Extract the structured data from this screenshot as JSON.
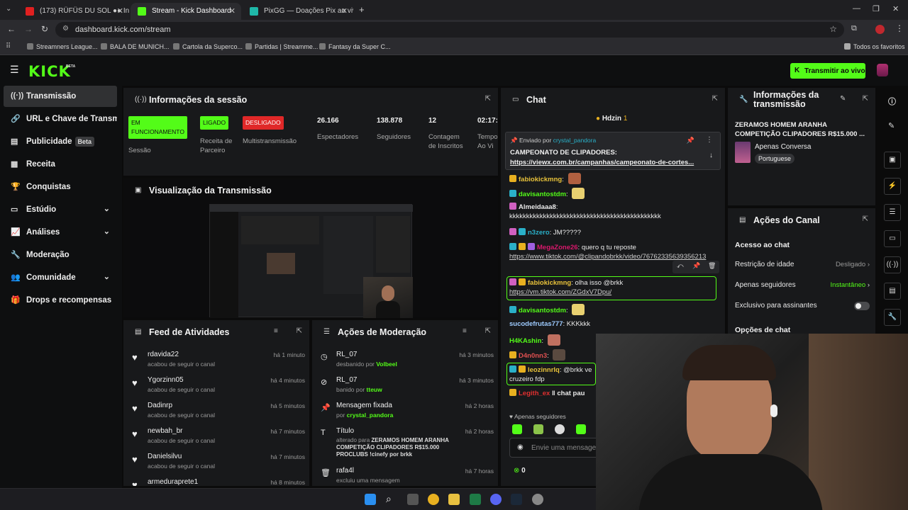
{
  "browser": {
    "tabs": [
      {
        "title": "(173) RÜFÜS DU SOL ●● Innerb",
        "active": false
      },
      {
        "title": "Stream - Kick Dashboard",
        "active": true
      },
      {
        "title": "PixGG — Doações Pix ao vivo p",
        "active": false
      }
    ],
    "url": "dashboard.kick.com/stream",
    "bookmarks": [
      "Streamners League...",
      "BALA DE MUNICH...",
      "Cartola da Superco...",
      "Partidas | Streamme...",
      "Fantasy da Super C..."
    ],
    "all_bookmarks": "Todos os favoritos"
  },
  "header": {
    "logo": "KICK",
    "beta": "BETA",
    "go_live": "Transmitir ao vivo",
    "accent": "#53fc18"
  },
  "sidebar": {
    "items": [
      {
        "label": "Transmissão",
        "icon": "broadcast-icon",
        "active": true
      },
      {
        "label": "URL e Chave de Transmissão",
        "icon": "link-icon"
      },
      {
        "label": "Publicidade",
        "icon": "ad-icon",
        "badge": "Beta"
      },
      {
        "label": "Receita",
        "icon": "revenue-icon"
      },
      {
        "label": "Conquistas",
        "icon": "trophy-icon"
      },
      {
        "label": "Estúdio",
        "icon": "studio-icon",
        "chevron": true
      },
      {
        "label": "Análises",
        "icon": "chart-icon",
        "chevron": true
      },
      {
        "label": "Moderação",
        "icon": "wrench-icon"
      },
      {
        "label": "Comunidade",
        "icon": "community-icon",
        "chevron": true
      },
      {
        "label": "Drops e recompensas",
        "icon": "drops-icon"
      }
    ]
  },
  "session": {
    "title": "Informações da sessão",
    "stats": [
      {
        "pill": "EM FUNCIONAMENTO",
        "label": "Sessão"
      },
      {
        "pill": "LIGADO",
        "label": "Receita de Parceiro"
      },
      {
        "pill": "DESLIGADO",
        "label": "Multistransmissão"
      },
      {
        "value": "26.166",
        "label": "Espectadores"
      },
      {
        "value": "138.878",
        "label": "Seguidores"
      },
      {
        "value": "12",
        "label": "Contagem de Inscritos"
      },
      {
        "value": "02:17:",
        "label": "Tempo Ao Vi"
      }
    ]
  },
  "preview": {
    "title": "Visualização da Transmissão"
  },
  "feed": {
    "title": "Feed de Atividades",
    "items": [
      {
        "name": "rdavida22",
        "action": "acabou de seguir o canal",
        "time": "há 1 minuto"
      },
      {
        "name": "Ygorzinn05",
        "action": "acabou de seguir o canal",
        "time": "há 4 minutos"
      },
      {
        "name": "Dadinrp",
        "action": "acabou de seguir o canal",
        "time": "há 5 minutos"
      },
      {
        "name": "newbah_br",
        "action": "acabou de seguir o canal",
        "time": "há 7 minutos"
      },
      {
        "name": "Danielsilvu",
        "action": "acabou de seguir o canal",
        "time": "há 7 minutos"
      },
      {
        "name": "armeduraprete1",
        "action": "",
        "time": "há 8 minutos"
      }
    ]
  },
  "mod": {
    "title": "Ações de Moderação",
    "items": [
      {
        "name": "RL_07",
        "pre": "desbanido por",
        "by": "Volbeel",
        "time": "há 3 minutos",
        "icon": "clock-icon"
      },
      {
        "name": "RL_07",
        "pre": "banido por",
        "by": "tteuw",
        "time": "há 3 minutos",
        "icon": "ban-icon"
      },
      {
        "name": "Mensagem fixada",
        "pre": "por",
        "by": "crystal_pandora",
        "time": "há 2 horas",
        "icon": "pin-icon"
      },
      {
        "name": "Título",
        "pre": "alterado para",
        "by": "ZERAMOS HOMEM ARANHA COMPETIÇÃO CLIPADORES R$15.000 PROCLUBS !cinefy por brkk",
        "time": "há 2 horas",
        "icon": "text-icon"
      },
      {
        "name": "rafa4l",
        "pre": "excluiu uma mensagem",
        "by": "",
        "time": "há 7 horas",
        "icon": "trash-icon"
      }
    ]
  },
  "chat": {
    "title": "Chat",
    "top_gifter": "Hdzin",
    "top_gifter_count": "1",
    "pinned": {
      "by_label": "Enviado por",
      "by": "crystal_pandora",
      "text": "CAMPEONATO DE CLIPADORES:",
      "link": "https://viewx.com.br/campanhas/campeonato-de-cortes..."
    },
    "messages": [
      {
        "user": "fabiokickmng",
        "color": "#e8c23a",
        "text": ""
      },
      {
        "user": "davisantostdm",
        "color": "#53fc18",
        "text": ""
      },
      {
        "user": "Almeidaaa8",
        "color": "#f0f0f0",
        "text": "kkkkkkkkkkkkkkkkkkkkkkkkkkkkkkkkkkkkkkkkkkkkk"
      },
      {
        "user": "n3zero",
        "color": "#f0f0f0",
        "text": "JM?????"
      },
      {
        "user": "MegaZone26",
        "color": "#d9186c",
        "text": "quero q tu reposte"
      },
      {
        "user": "",
        "color": "",
        "text": "https://www.tiktok.com/@clipandobrkk/video/76762335639356213"
      },
      {
        "user": "fabiokickmng",
        "color": "#e8c23a",
        "text": "olha isso @brkk"
      },
      {
        "user": "",
        "color": "",
        "text": "https://vm.tiktok.com/ZGdxV7Dpu/"
      },
      {
        "user": "davisantostdm",
        "color": "#53fc18",
        "text": ""
      },
      {
        "user": "sucodefrutas777",
        "color": "#9ecbff",
        "text": "KKKkkk"
      },
      {
        "user": "H4KAshin",
        "color": "#53fc18",
        "text": ""
      },
      {
        "user": "D4n0nn3",
        "color": "#e05050",
        "text": ""
      },
      {
        "user": "leozinnrlq",
        "color": "#e8c23a",
        "text": "@brkk ve cruzeiro fdp"
      },
      {
        "user": "Legith_ex",
        "color": "#e03030",
        "text": "chat pau"
      }
    ],
    "followers_only": "Apenas seguidores",
    "input_placeholder": "Envie uma mensagem",
    "points": "0"
  },
  "stream_info": {
    "title": "Informações da transmissão",
    "stream_title": "ZERAMOS HOMEM ARANHA COMPETIÇÃO CLIPADORES R$15.000 ...",
    "category": "Apenas Conversa",
    "language": "Portuguese"
  },
  "channel": {
    "title": "Ações do Canal",
    "section": "Acesso ao chat",
    "rows": [
      {
        "label": "Restrição de idade",
        "value": "Desligado"
      },
      {
        "label": "Apenas seguidores",
        "value": "Instantâneo"
      },
      {
        "label": "Exclusivo para assinantes",
        "value": ""
      }
    ],
    "chat_options": "Opções de chat"
  }
}
